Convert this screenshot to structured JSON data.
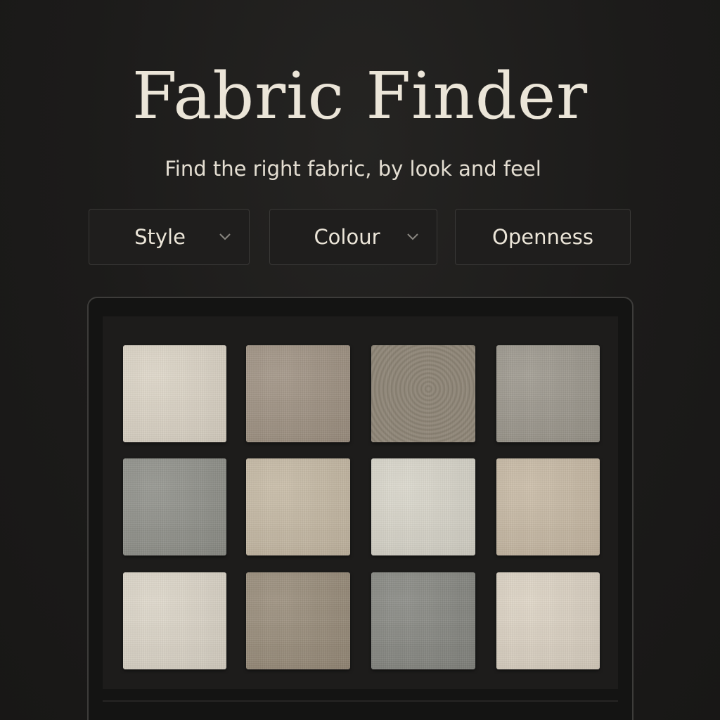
{
  "header": {
    "title": "Fabric Finder",
    "subtitle": "Find the right fabric, by look and feel"
  },
  "filters": [
    {
      "label": "Style",
      "icon": "chevron-down-icon"
    },
    {
      "label": "Colour",
      "icon": "chevron-down-icon"
    },
    {
      "label": "Openness"
    }
  ],
  "swatch_grid": {
    "swatches": [
      {
        "color": "#ddd5c6"
      },
      {
        "color": "#9e9080"
      },
      {
        "color": "#8f8677"
      },
      {
        "color": "#9b968b"
      },
      {
        "color": "#8e8f88"
      },
      {
        "color": "#c6b9a3"
      },
      {
        "color": "#d9d6ca"
      },
      {
        "color": "#c8b9a3"
      },
      {
        "color": "#ddd6c8"
      },
      {
        "color": "#978a77"
      },
      {
        "color": "#84857f"
      },
      {
        "color": "#ddd3c3"
      }
    ]
  },
  "colors": {
    "background": "#1c1b1a",
    "text": "#ebe5d8",
    "border": "#3a3937"
  }
}
